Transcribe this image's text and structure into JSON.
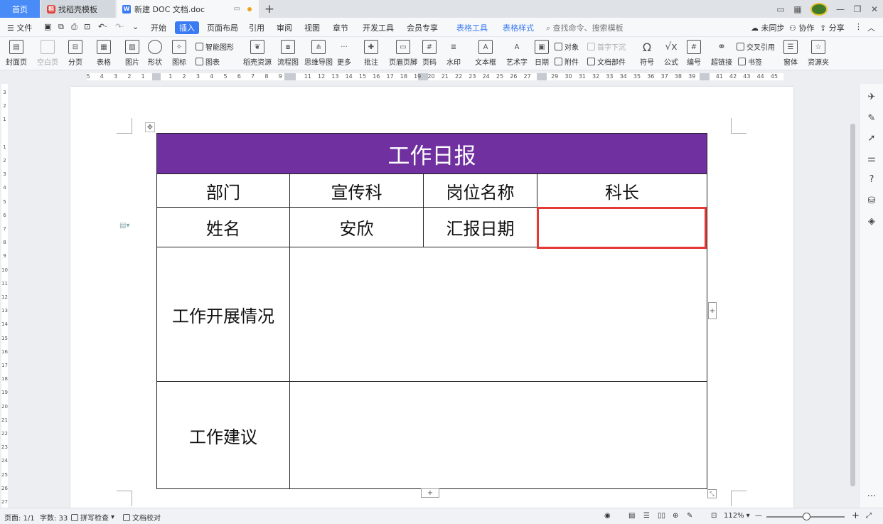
{
  "tabs": {
    "home": "首页",
    "templates": "找稻壳模板",
    "doc": "新建 DOC 文档.doc",
    "new_tab": "+"
  },
  "menu": {
    "file": "文件",
    "items": [
      "开始",
      "插入",
      "页面布局",
      "引用",
      "审阅",
      "视图",
      "章节",
      "开发工具",
      "会员专享",
      "表格工具",
      "表格样式"
    ],
    "active": "插入",
    "search": "查找命令、搜索模板",
    "sync": "未同步",
    "collab": "协作",
    "share": "分享"
  },
  "ribbon": {
    "cover": "封面页",
    "blank": "空白页",
    "pagebreak": "分页",
    "table": "表格",
    "picture": "图片",
    "shape": "形状",
    "icon": "图标",
    "smartart": "智能图形",
    "chart": "图表",
    "resources": "稻壳资源",
    "flowchart": "流程图",
    "mindmap": "思维导图",
    "more": "更多",
    "comment": "批注",
    "header_footer": "页眉页脚",
    "page_number": "页码",
    "watermark": "水印",
    "textbox": "文本框",
    "wordart": "艺术字",
    "date": "日期",
    "object": "对象",
    "attachment": "附件",
    "dropcap": "首字下沉",
    "doc_parts": "文档部件",
    "symbol": "符号",
    "formula": "公式",
    "numbering": "编号",
    "crossref": "交叉引用",
    "hyperlink": "超链接",
    "bookmark": "书签",
    "form": "窗体",
    "resource_folder": "资源夹"
  },
  "ruler_numbers": [
    "5",
    "4",
    "3",
    "2",
    "1",
    "",
    "1",
    "2",
    "3",
    "4",
    "5",
    "6",
    "7",
    "8",
    "9",
    "",
    "11",
    "12",
    "13",
    "14",
    "15",
    "16",
    "17",
    "18",
    "19",
    "20",
    "21",
    "22",
    "23",
    "24",
    "25",
    "26",
    "27",
    "",
    "29",
    "30",
    "31",
    "32",
    "33",
    "34",
    "35",
    "36",
    "37",
    "38",
    "39",
    "",
    "41",
    "42",
    "43",
    "44",
    "45"
  ],
  "vruler_numbers": [
    "3",
    "2",
    "1",
    "",
    "1",
    "2",
    "3",
    "4",
    "5",
    "6",
    "7",
    "8",
    "9",
    "10",
    "11",
    "12",
    "13",
    "14",
    "15",
    "16",
    "17",
    "18",
    "19",
    "20",
    "21",
    "22",
    "23",
    "24",
    "25",
    "26",
    "27"
  ],
  "table": {
    "title": "工作日报",
    "dept_label": "部门",
    "dept_value": "宣传科",
    "position_label": "岗位名称",
    "position_value": "科长",
    "name_label": "姓名",
    "name_value": "安欣",
    "date_label": "汇报日期",
    "date_value": "",
    "progress_label": "工作开展情况",
    "progress_value": "",
    "suggestion_label": "工作建议",
    "suggestion_value": ""
  },
  "status": {
    "page": "页面: 1/1",
    "words": "字数: 33",
    "spellcheck": "拼写检查",
    "proofread": "文档校对",
    "zoom": "112%"
  },
  "colors": {
    "accent": "#3a7af2",
    "table_header": "#7030a0",
    "selection": "#e53935"
  }
}
